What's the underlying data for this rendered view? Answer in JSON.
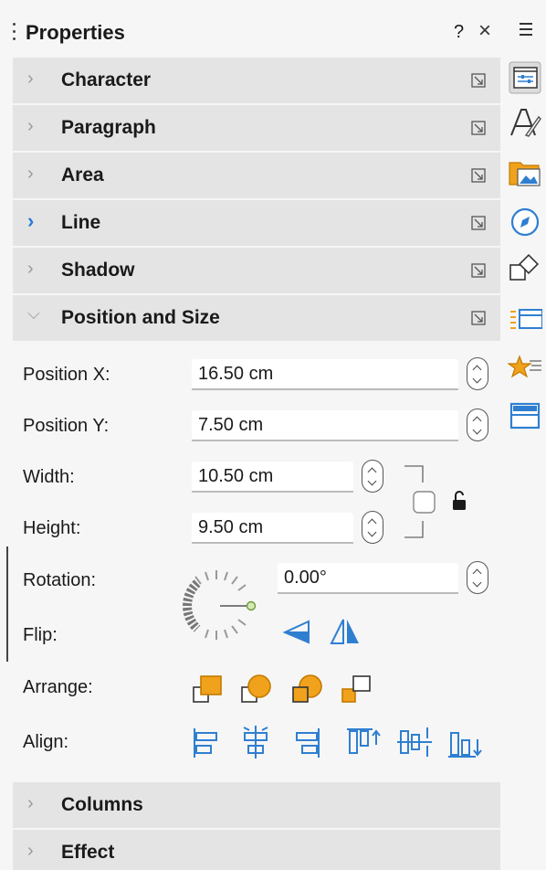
{
  "panel": {
    "title": "Properties",
    "help_label": "?",
    "close_label": "×"
  },
  "sections": {
    "character": "Character",
    "paragraph": "Paragraph",
    "area": "Area",
    "line": "Line",
    "shadow": "Shadow",
    "position_size": "Position and Size",
    "columns": "Columns",
    "effect": "Effect"
  },
  "position_size": {
    "position_x_label": "Position X:",
    "position_x_value": "16.50 cm",
    "position_y_label": "Position Y:",
    "position_y_value": "7.50 cm",
    "width_label": "Width:",
    "width_value": "10.50 cm",
    "height_label": "Height:",
    "height_value": "9.50 cm",
    "rotation_label": "Rotation:",
    "rotation_value": "0.00°",
    "flip_label": "Flip:",
    "arrange_label": "Arrange:",
    "align_label": "Align:"
  },
  "colors": {
    "accent": "#2a7ad6",
    "icon_orange": "#f0a21c",
    "icon_blue": "#2f7fd1",
    "section_bg": "#e4e4e4"
  }
}
